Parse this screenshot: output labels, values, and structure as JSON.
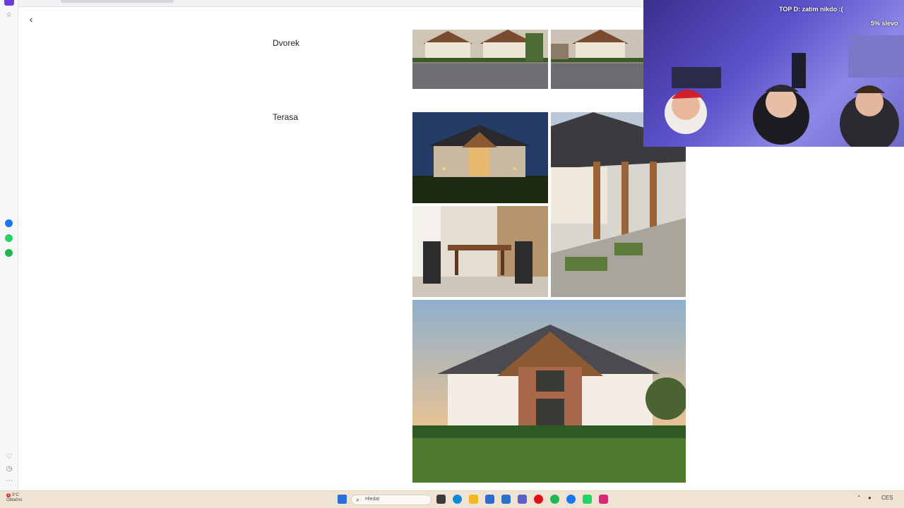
{
  "sidebar": {
    "items": [
      {
        "name": "opera-logo-icon"
      },
      {
        "name": "pin-icon"
      },
      {
        "name": "messenger-icon",
        "color": "#1877f2"
      },
      {
        "name": "whatsapp-icon",
        "color": "#25d366"
      },
      {
        "name": "spotify-icon",
        "color": "#1db954"
      },
      {
        "name": "heart-icon"
      },
      {
        "name": "history-icon"
      },
      {
        "name": "more-icon"
      }
    ]
  },
  "page": {
    "back_icon": "‹",
    "sections": [
      {
        "label": "Dvorek"
      },
      {
        "label": "Terasa"
      }
    ]
  },
  "overlay": {
    "top_text": "TOP D: zatím nikdo :(",
    "discount_text": "5% slevo"
  },
  "taskbar": {
    "search_placeholder": "Hledat",
    "weather_temp": "3°C",
    "weather_desc": "Oblačno",
    "weather_badge": "1",
    "lang": "CES",
    "icons": [
      "start-icon",
      "search-icon",
      "file-explorer-icon",
      "edge-icon",
      "folder-icon",
      "store-icon",
      "mail-icon",
      "teams-icon",
      "opera-icon",
      "spotify-icon",
      "messenger-icon",
      "whatsapp-icon",
      "instagram-icon"
    ]
  },
  "colors": {
    "accent": "#6a3ed8",
    "taskbar_bg": "#efe3d4"
  }
}
